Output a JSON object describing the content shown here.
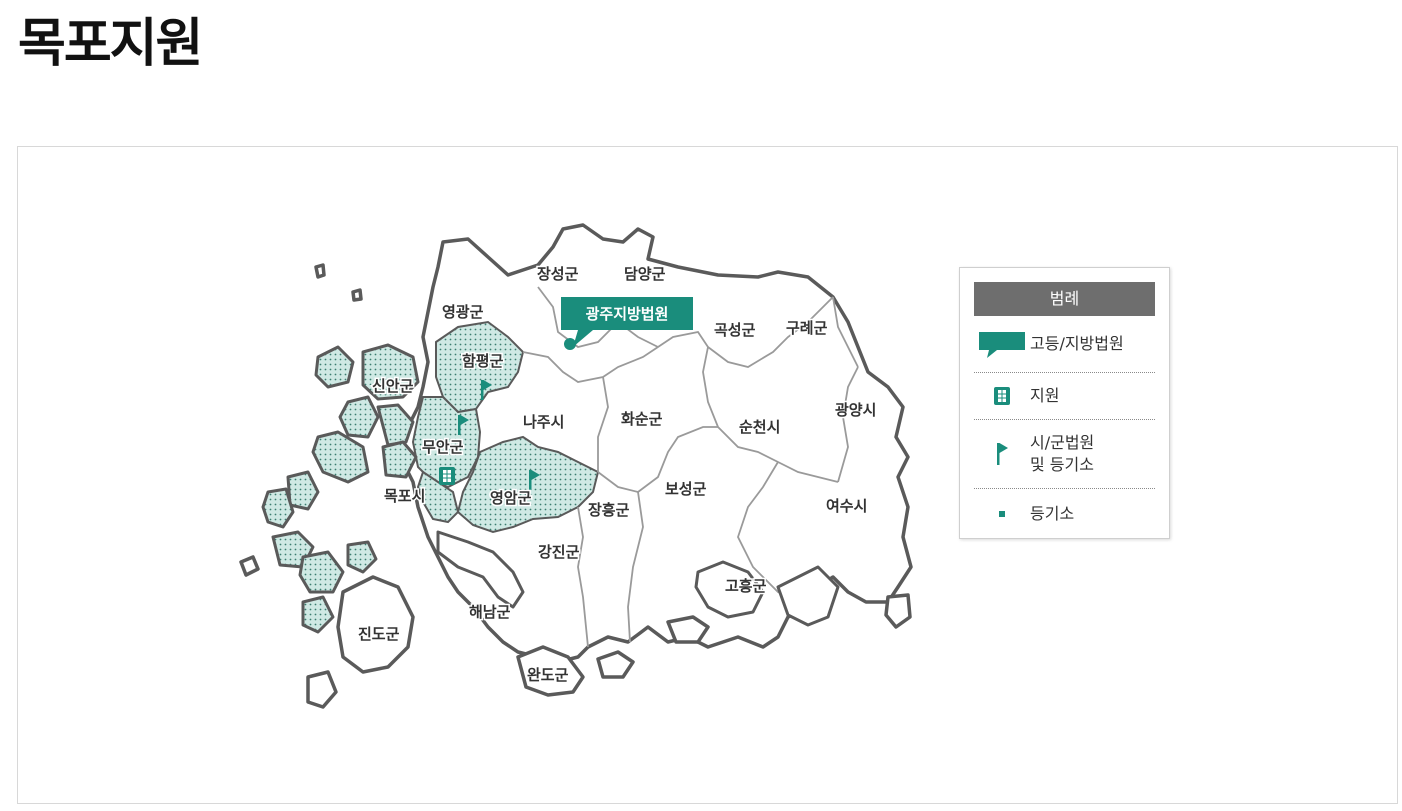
{
  "title": "목포지원",
  "map": {
    "court_label": "광주지방법원",
    "regions": [
      {
        "id": "jangseong",
        "name": "장성군"
      },
      {
        "id": "damyang",
        "name": "담양군"
      },
      {
        "id": "yeonggwang",
        "name": "영광군"
      },
      {
        "id": "gokseong",
        "name": "곡성군"
      },
      {
        "id": "gurye",
        "name": "구례군"
      },
      {
        "id": "hampyeong",
        "name": "함평군"
      },
      {
        "id": "sinan",
        "name": "신안군"
      },
      {
        "id": "naju",
        "name": "나주시"
      },
      {
        "id": "hwasun",
        "name": "화순군"
      },
      {
        "id": "suncheon",
        "name": "순천시"
      },
      {
        "id": "gwangyang",
        "name": "광양시"
      },
      {
        "id": "muan",
        "name": "무안군"
      },
      {
        "id": "mokpo",
        "name": "목포시"
      },
      {
        "id": "yeongam",
        "name": "영암군"
      },
      {
        "id": "boseong",
        "name": "보성군"
      },
      {
        "id": "jangheung",
        "name": "장흥군"
      },
      {
        "id": "yeosu",
        "name": "여수시"
      },
      {
        "id": "gangjin",
        "name": "강진군"
      },
      {
        "id": "goheung",
        "name": "고흥군"
      },
      {
        "id": "haenam",
        "name": "해남군"
      },
      {
        "id": "jindo",
        "name": "진도군"
      },
      {
        "id": "wando",
        "name": "완도군"
      }
    ],
    "highlight_color": "#cfe9e4",
    "accent_color": "#1a8d7c"
  },
  "legend": {
    "title": "범례",
    "items": [
      {
        "icon": "speech-tag-icon",
        "label": "고등/지방법원"
      },
      {
        "icon": "building-icon",
        "label": "지원"
      },
      {
        "icon": "flag-icon",
        "label": "시/군법원",
        "label2": "및 등기소"
      },
      {
        "icon": "square-dot-icon",
        "label": "등기소"
      }
    ]
  }
}
